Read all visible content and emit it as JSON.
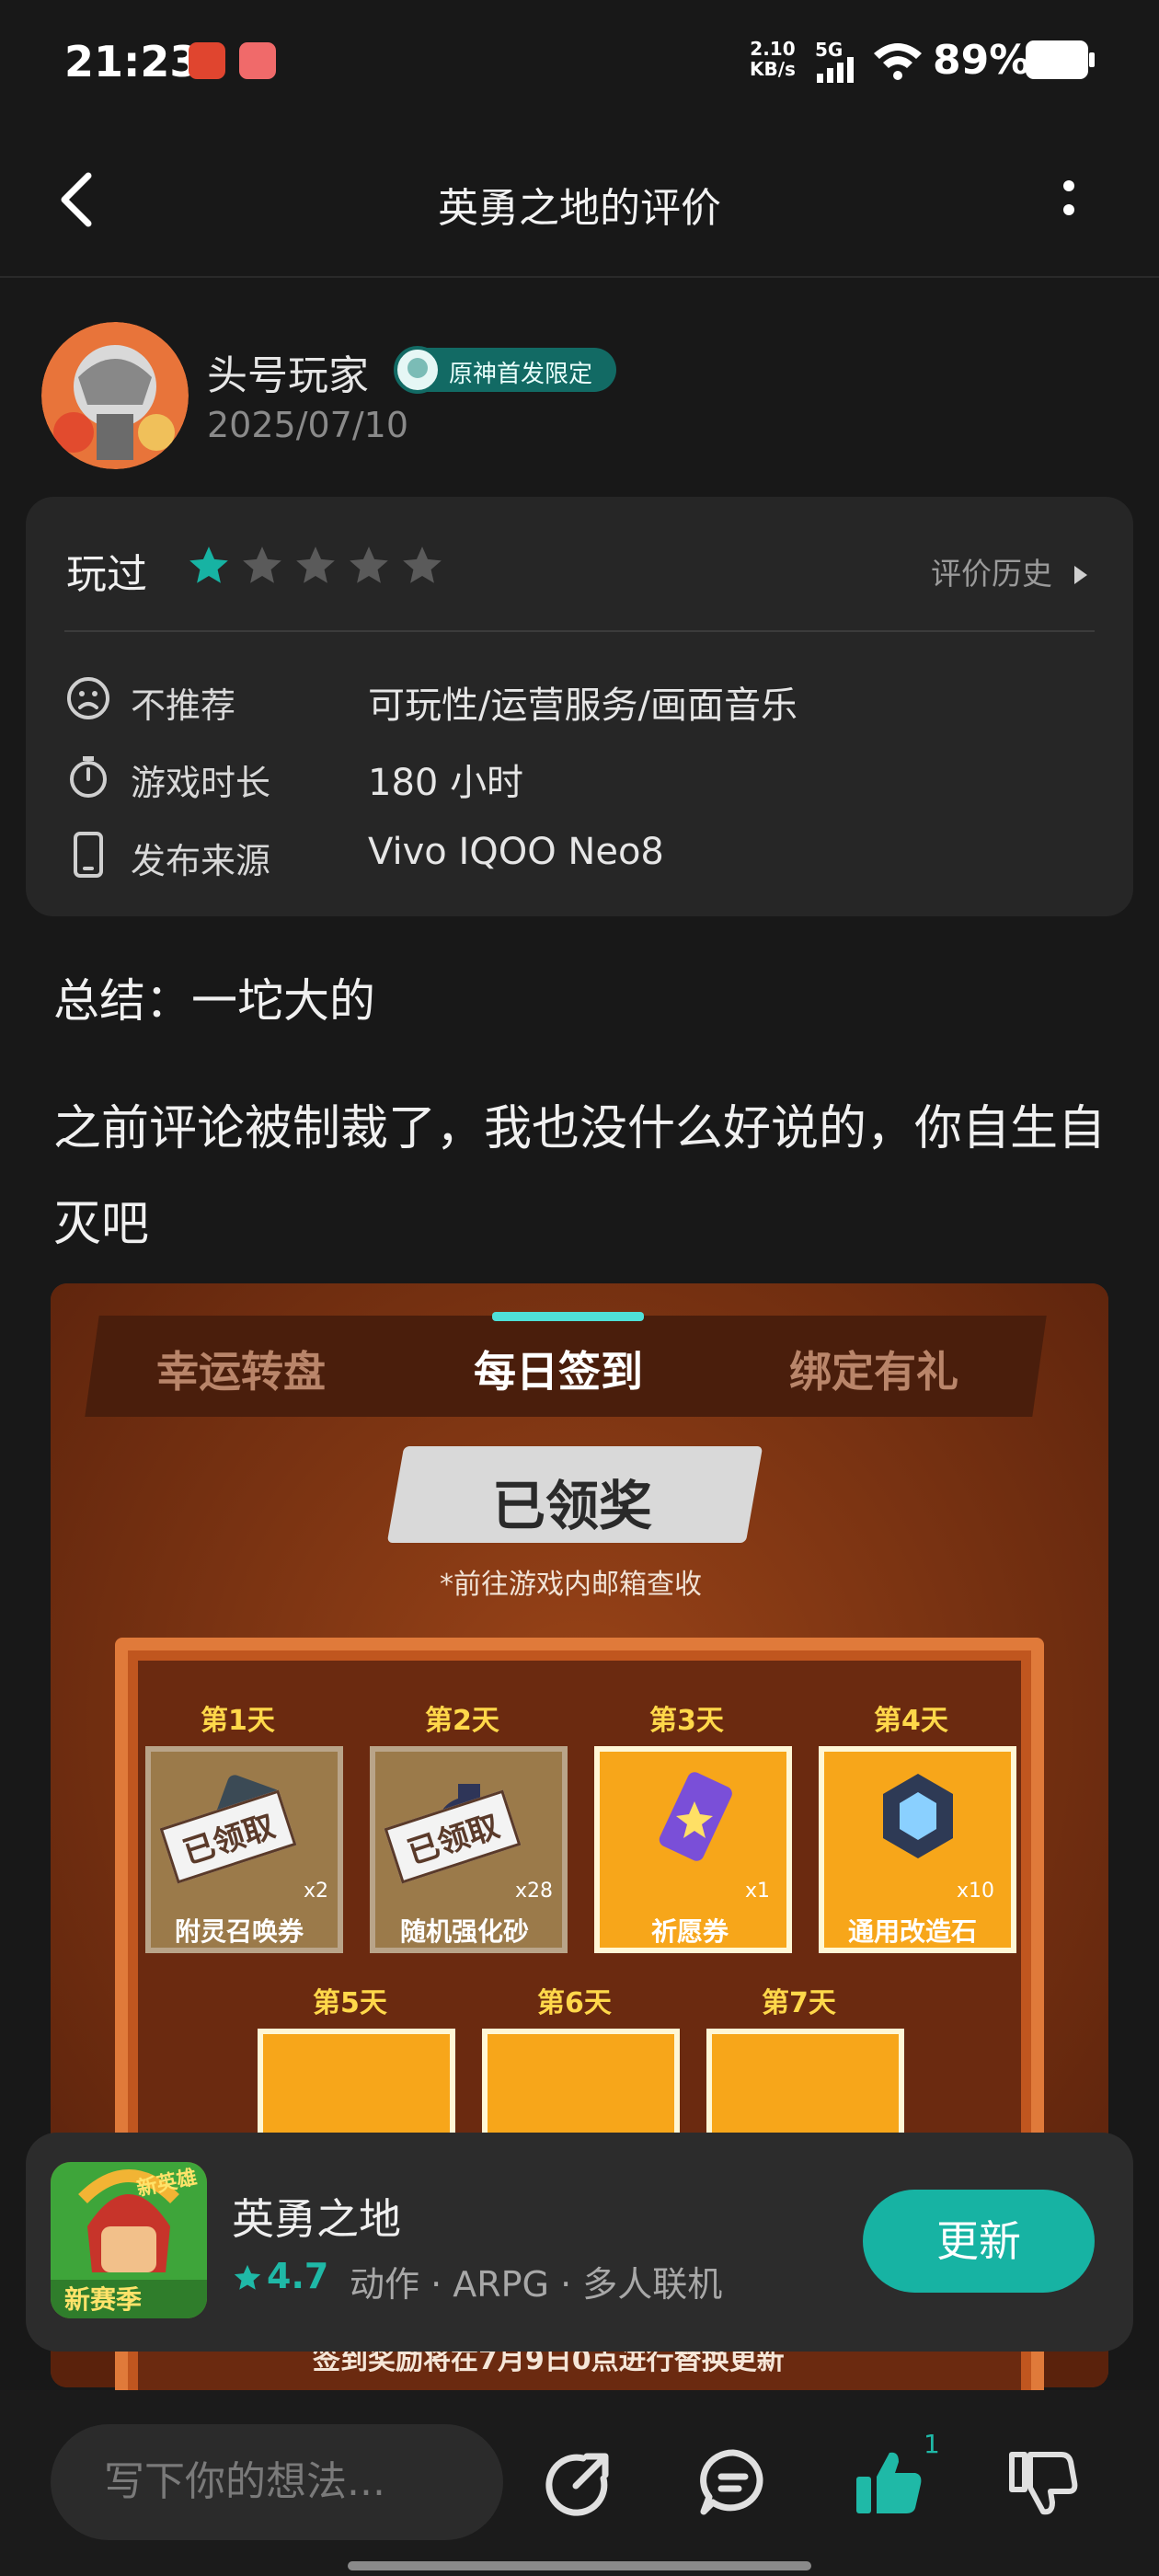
{
  "status_bar": {
    "time": "21:23",
    "net_speed_value": "2.10",
    "net_speed_unit": "KB/s",
    "signal": "5G",
    "battery": "89%"
  },
  "header": {
    "title": "英勇之地的评价"
  },
  "review": {
    "author": "头号玩家",
    "badge": "原神首发限定",
    "date": "2025/07/10",
    "played_label": "玩过",
    "rating": 1,
    "max_rating": 5,
    "history_label": "评价历史",
    "details": [
      {
        "icon": "sad-face-icon",
        "label": "不推荐",
        "value": "可玩性/运营服务/画面音乐"
      },
      {
        "icon": "stopwatch-icon",
        "label": "游戏时长",
        "value": "180 小时"
      },
      {
        "icon": "phone-icon",
        "label": "发布来源",
        "value": "Vivo IQOO Neo8"
      }
    ],
    "summary": "总结：一坨大的",
    "paragraph": "之前评论被制裁了，我也没什么好说的，你自生自灭吧"
  },
  "screenshot": {
    "tabs": [
      "幸运转盘",
      "每日签到",
      "绑定有礼"
    ],
    "claimed_banner": "已领奖",
    "mail_note": "*前往游戏内邮箱查收",
    "days": [
      {
        "day": "第1天",
        "item": "附灵召唤券",
        "qty": "x2",
        "claimed": true,
        "stamp": "已领取"
      },
      {
        "day": "第2天",
        "item": "随机强化砂",
        "qty": "x28",
        "claimed": true,
        "stamp": "已领取"
      },
      {
        "day": "第3天",
        "item": "祈愿券",
        "qty": "x1",
        "claimed": false
      },
      {
        "day": "第4天",
        "item": "通用改造石",
        "qty": "x10",
        "claimed": false
      },
      {
        "day": "第5天"
      },
      {
        "day": "第6天"
      },
      {
        "day": "第7天"
      }
    ],
    "footer_note": "签到奖励将在7月9日0点进行替换更新"
  },
  "game_bar": {
    "name": "英勇之地",
    "rating": "4.7",
    "tags": "动作 · ARPG · 多人联机",
    "icon_badge_top": "新英雄",
    "icon_badge_bottom": "新赛季",
    "update_label": "更新"
  },
  "bottom_bar": {
    "input_placeholder": "写下你的想法...",
    "like_count": "1"
  },
  "colors": {
    "accent": "#17b3a3",
    "background": "#181818",
    "card": "#262626"
  }
}
